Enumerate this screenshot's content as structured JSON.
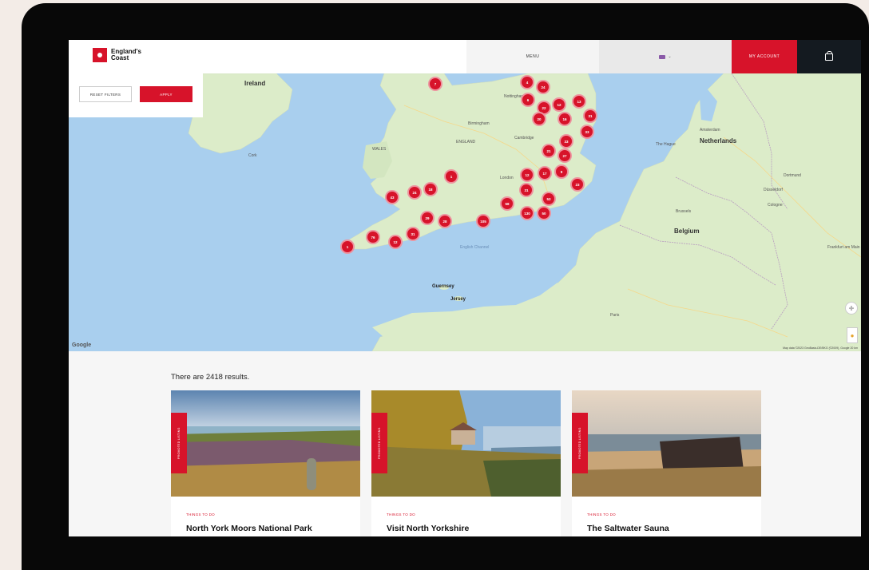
{
  "header": {
    "logo_text": "England's Coast",
    "menu_label": "MENU",
    "lang_label": "•—",
    "account_label": "MY ACCOUNT"
  },
  "filters": {
    "reset_label": "RESET FILTERS",
    "apply_label": "APPLY"
  },
  "map": {
    "labels": {
      "ireland": "Ireland",
      "wales": "WALES",
      "england": "ENGLAND",
      "birmingham": "Birmingham",
      "netherlands": "Netherlands",
      "amsterdam": "Amsterdam",
      "belgium": "Belgium",
      "brussels": "Brussels",
      "guernsey": "Guernsey",
      "jersey": "Jersey",
      "paris": "Paris",
      "nottingham": "Nottingham",
      "cambridge": "Cambridge",
      "london": "London",
      "cologne": "Cologne",
      "dusseldorf": "Düsseldorf",
      "frankfurt": "Frankfurt am Main",
      "dortmund": "Dortmund",
      "english_channel": "English Channel",
      "cork": "Cork",
      "the_hague": "The Hague"
    },
    "google_label": "Google",
    "attribution": "Map data ©2023 GeoBasis-DE/BKG (©2009), Google   20 km"
  },
  "clusters": [
    "7",
    "4",
    "24",
    "6",
    "22",
    "12",
    "13",
    "20",
    "16",
    "31",
    "33",
    "33",
    "27",
    "21",
    "1",
    "12",
    "17",
    "9",
    "31",
    "23",
    "43",
    "24",
    "18",
    "58",
    "53",
    "50",
    "130",
    "105",
    "28",
    "29",
    "76",
    "12",
    "31",
    "1"
  ],
  "results": {
    "count_text": "There are 2418 results.",
    "cards": [
      {
        "tag": "PROMOTED LISTING",
        "category": "THINGS TO DO",
        "title": "North York Moors National Park"
      },
      {
        "tag": "PROMOTED LISTING",
        "category": "THINGS TO DO",
        "title": "Visit North Yorkshire"
      },
      {
        "tag": "PROMOTED LISTING",
        "category": "THINGS TO DO",
        "title": "The Saltwater Sauna"
      }
    ]
  },
  "colors": {
    "brand_red": "#d7132a",
    "dark_nav": "#141a20",
    "sea": "#a9cfee",
    "land": "#dcecc9"
  }
}
